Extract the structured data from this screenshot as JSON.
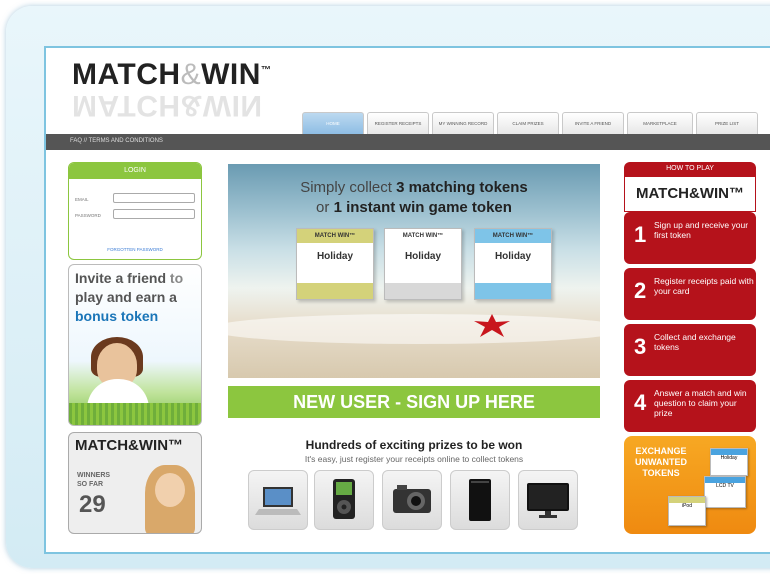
{
  "header": {
    "logo_main": "MATCH",
    "logo_amp": "&",
    "logo_end": "WIN",
    "logo_tm": "™"
  },
  "tabs": [
    {
      "label": "HOME",
      "active": true
    },
    {
      "label": "REGISTER RECEIPTS",
      "active": false
    },
    {
      "label": "MY WINNING RECORD",
      "active": false
    },
    {
      "label": "CLAIM PRIZES",
      "active": false
    },
    {
      "label": "INVITE A FRIEND",
      "active": false
    },
    {
      "label": "MARKETPLACE",
      "active": false
    },
    {
      "label": "PRIZE LIST",
      "active": false
    }
  ],
  "subnav": "FAQ // TERMS AND CONDITIONS",
  "login": {
    "title": "LOGIN",
    "email_label": "EMAIL",
    "password_label": "PASSWORD",
    "forgotten": "FORGOTTEN PASSWORD"
  },
  "invite": {
    "line1": "Invite a friend",
    "line1b": " to",
    "line2": "play and earn a",
    "line3": "bonus token"
  },
  "winners": {
    "logo": "MATCH&WIN™",
    "label1": "WINNERS",
    "label2": "SO FAR",
    "count": "29"
  },
  "hero": {
    "line1_pre": "Simply collect ",
    "line1_bold": "3 matching tokens",
    "line2_pre": "or ",
    "line2_bold": "1 instant win game token",
    "cards": [
      {
        "header": "MATCH WIN™",
        "label": "Holiday",
        "footer_color": "#d4d27a",
        "header_color": "#d4d27a"
      },
      {
        "header": "MATCH WIN™",
        "label": "Holiday",
        "footer_color": "#d8d8d8",
        "header_color": "#ffffff"
      },
      {
        "header": "MATCH WIN™",
        "label": "Holiday",
        "footer_color": "#7ec4e8",
        "header_color": "#7ec4e8"
      }
    ]
  },
  "signup": "NEW USER - SIGN UP HERE",
  "prizes": {
    "title": "Hundreds of exciting prizes to be won",
    "subtitle": "It's easy, just register your receipts online to collect tokens",
    "items": [
      "laptop-icon",
      "ipod-icon",
      "camera-icon",
      "console-icon",
      "tv-icon"
    ]
  },
  "how_to_play": {
    "title": "HOW TO PLAY",
    "logo": "MATCH&WIN™",
    "steps": [
      {
        "n": "1",
        "text": "Sign up and receive your first token"
      },
      {
        "n": "2",
        "text": "Register receipts paid with your card"
      },
      {
        "n": "3",
        "text": "Collect and exchange tokens"
      },
      {
        "n": "4",
        "text": "Answer a match and win question to claim your prize"
      }
    ]
  },
  "exchange": {
    "line1": "EXCHANGE",
    "line2": "UNWANTED",
    "line3": "TOKENS",
    "tokens": [
      "Holiday",
      "LCD TV",
      "iPod"
    ]
  },
  "colors": {
    "green": "#8cc63f",
    "red": "#b5121b",
    "orange": "#f39a1c",
    "blue": "#1a75b8"
  }
}
